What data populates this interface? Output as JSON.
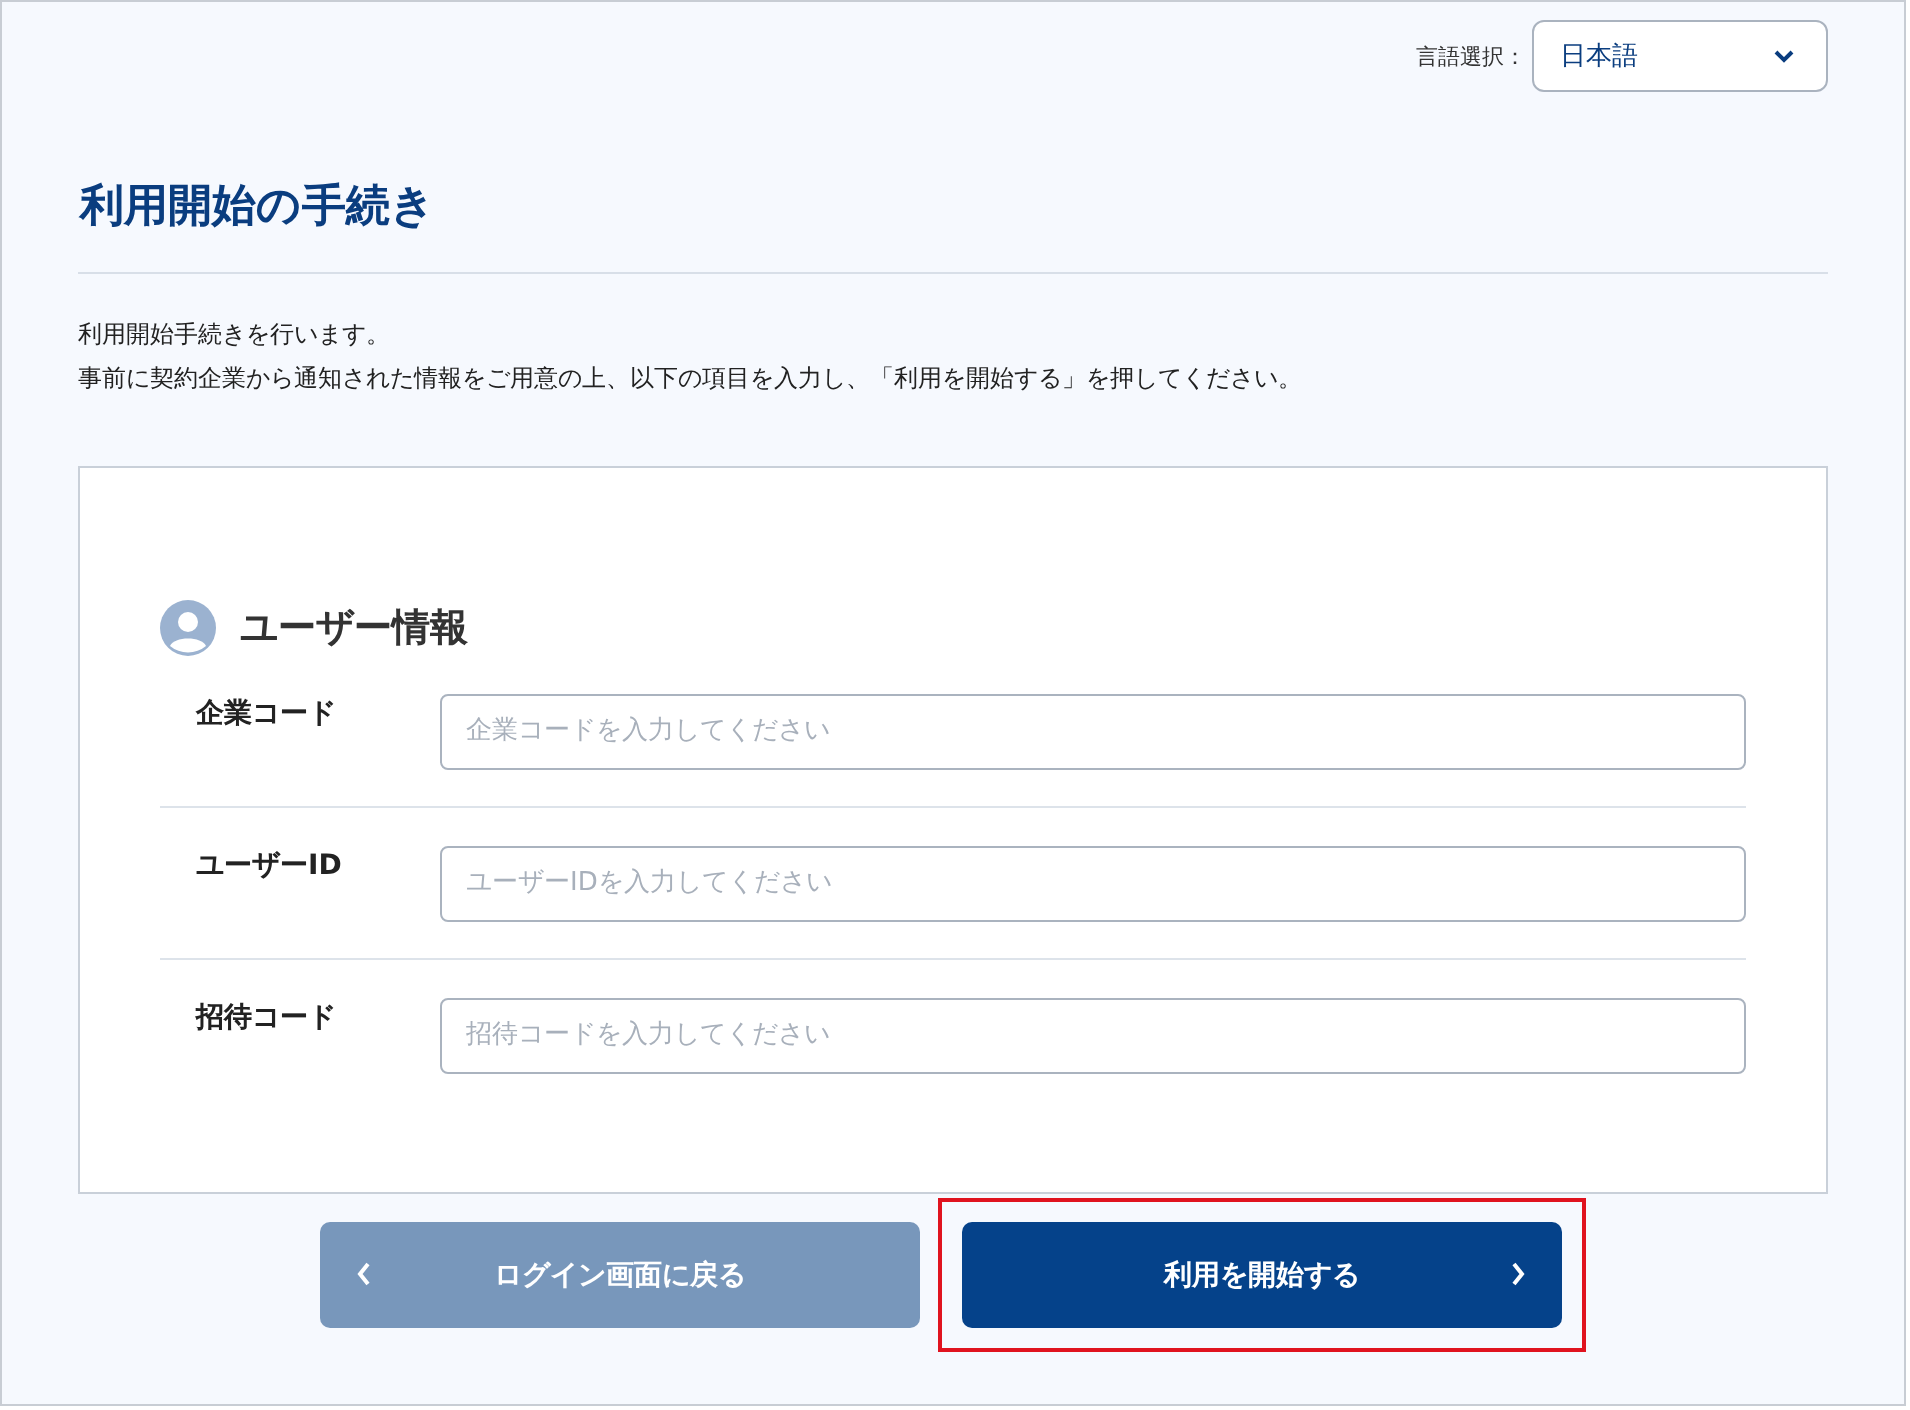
{
  "language": {
    "label": "言語選択：",
    "value": "日本語"
  },
  "title": "利用開始の手続き",
  "description": [
    "利用開始手続きを行います。",
    "事前に契約企業から通知された情報をご用意の上、以下の項目を入力し、「利用を開始する」を押してください。"
  ],
  "section": {
    "heading": "ユーザー情報",
    "fields": [
      {
        "label": "企業コード",
        "placeholder": "企業コードを入力してください"
      },
      {
        "label": "ユーザーID",
        "placeholder": "ユーザーIDを入力してください"
      },
      {
        "label": "招待コード",
        "placeholder": "招待コードを入力してください"
      }
    ]
  },
  "buttons": {
    "back": {
      "label": "ログイン画面に戻る"
    },
    "start": {
      "label": "利用を開始する",
      "highlighted": true
    }
  }
}
